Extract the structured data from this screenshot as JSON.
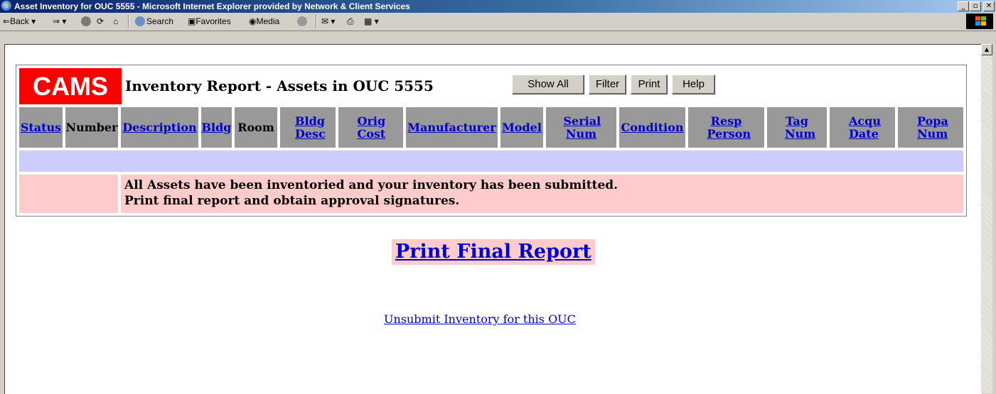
{
  "window": {
    "title": "Asset Inventory for OUC 5555 - Microsoft Internet Explorer provided by Network & Client Services",
    "controls": [
      "_",
      "▫",
      "✕"
    ]
  },
  "toolbar": {
    "back": "Back",
    "search": "Search",
    "favorites": "Favorites",
    "media": "Media"
  },
  "report": {
    "logo": "CAMS",
    "title": "Inventory Report - Assets in OUC 5555",
    "buttons": {
      "show_all": "Show All",
      "filter": "Filter",
      "print": "Print",
      "help": "Help"
    },
    "columns": [
      {
        "label": "Status",
        "link": true
      },
      {
        "label": "Number",
        "link": false
      },
      {
        "label": "Description",
        "link": true
      },
      {
        "label": "Bldg",
        "link": true
      },
      {
        "label": "Room",
        "link": false
      },
      {
        "label": "Bldg Desc",
        "link": true
      },
      {
        "label": "Orig Cost",
        "link": true
      },
      {
        "label": "Manufacturer",
        "link": true
      },
      {
        "label": "Model",
        "link": true
      },
      {
        "label": "Serial Num",
        "link": true
      },
      {
        "label": "Condition",
        "link": true
      },
      {
        "label": "Resp Person",
        "link": true
      },
      {
        "label": "Tag Num",
        "link": true
      },
      {
        "label": "Acqu Date",
        "link": true
      },
      {
        "label": "Popa Num",
        "link": true
      }
    ],
    "message_line1": "All Assets have been inventoried and your inventory has been submitted.",
    "message_line2": "Print final report and obtain approval signatures."
  },
  "actions": {
    "print_final": "Print Final Report",
    "unsubmit": "Unsubmit Inventory for this OUC"
  },
  "colors": {
    "logo_bg": "#ff0000",
    "header_bg": "#999999",
    "blue_row": "#ccccff",
    "pink_row": "#ffcccc",
    "link": "#0000cc"
  }
}
